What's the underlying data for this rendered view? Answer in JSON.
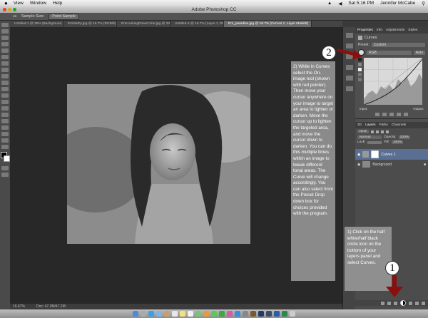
{
  "menubar": {
    "apple": "",
    "items": [
      "View",
      "Window",
      "Help"
    ],
    "right_status": "Sat 5:16 PM",
    "user": "Jennifer McCabe"
  },
  "window_title": "Adobe Photoshop CC",
  "options_bar": {
    "sample_label": "Sample Size:",
    "sample_value": "Point Sample"
  },
  "doc_tabs": [
    {
      "label": "Untitled-1 @ 25% (Background, RGB...",
      "active": false
    },
    {
      "label": "Emblathy.jpg @ 16.7% (RGB/8)",
      "active": false
    },
    {
      "label": "EmLookingDownColor.jpg @ 33.3%",
      "active": false
    },
    {
      "label": "Untitled-2 @ 16.7% (Layer 1, RGB/8)",
      "active": false
    },
    {
      "label": "Em_paradise.jpg @ 16.7% (Curves 1, Layer Mask/8)",
      "active": true
    }
  ],
  "status_bar": {
    "zoom": "16.67%",
    "doc": "Doc: 47.2M/47.2M"
  },
  "properties_panel": {
    "tabs": [
      "Properties",
      "Info",
      "Adjustments",
      "Styles"
    ],
    "title": "Curves",
    "preset_label": "Preset:",
    "preset_value": "Custom",
    "channel_value": "RGB",
    "auto_label": "Auto",
    "input_label": "Input:",
    "output_label": "Output:"
  },
  "layers_panel": {
    "tabs": [
      "3D",
      "Layers",
      "Paths",
      "Channels"
    ],
    "kind_label": "Kind",
    "blend_mode": "Normal",
    "opacity_label": "Opacity:",
    "opacity_value": "100%",
    "lock_label": "Lock:",
    "fill_label": "Fill:",
    "fill_value": "100%",
    "layers": [
      {
        "name": "Curves 1",
        "selected": true
      },
      {
        "name": "Background",
        "selected": false
      }
    ]
  },
  "annotations": {
    "step2_number": "2",
    "step2_text": "2) While in Curves select the On-image tool (shown with red pointer). Then move your cursor anywhere on your image to target an area to lighten or darken. Move the cursor up to lighten the targeted area, and move the cursor down to darken. You can do this multiple times within an image to tweak different tonal areas. The Curve will change accordingly. You can also select from the Preset Drop down box for choices provided with the program.",
    "step1_number": "1",
    "step1_text": "1) Click on the half white/half black circle icon on the bottom of your layers panel and select Curves."
  },
  "colors": {
    "accent_red": "#8b0f0f",
    "selected_layer": "#5a6f91",
    "annotation_bg": "#8a8a8a"
  }
}
